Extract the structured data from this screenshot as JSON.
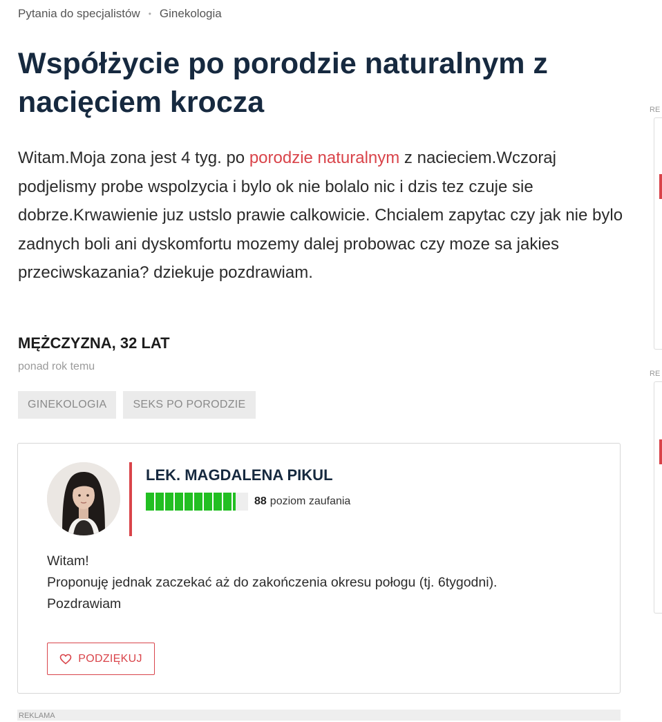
{
  "breadcrumb": {
    "items": [
      "Pytania do specjalistów",
      "Ginekologia"
    ],
    "separator": "•"
  },
  "question": {
    "title": "Współżycie po porodzie naturalnym z nacięciem krocza",
    "body_before_link": "Witam.Moja zona jest 4 tyg. po ",
    "body_link": "porodzie naturalnym",
    "body_after_link": " z nacieciem.Wczoraj podjelismy probe wspolzycia i bylo ok nie bolalo nic i dzis tez czuje sie dobrze.Krwawienie juz ustslo prawie calkowicie. Chcialem zapytac czy jak nie bylo zadnych boli ani dyskomfortu mozemy dalej probowac czy moze sa jakies przeciwskazania? dziekuje pozdrawiam.",
    "author": "MĘŻCZYZNA, 32 LAT",
    "time_ago": "ponad rok temu",
    "tags": [
      "GINEKOLOGIA",
      "SEKS PO PORODZIE"
    ]
  },
  "answer": {
    "doctor_name": "LEK. MAGDALENA PIKUL",
    "trust_score": "88",
    "trust_label": "poziom zaufania",
    "trust_fraction": 0.88,
    "text_lines": [
      "Witam!",
      "Proponuję jednak zaczekać aż do zakończenia okresu połogu (tj. 6tygodni).",
      "Pozdrawiam"
    ],
    "thanks_label": "PODZIĘKUJ",
    "thanks_icon": "heart-outline-icon"
  },
  "ads": {
    "bottom_label": "REKLAMA",
    "side_label_1": "RE",
    "side_label_2": "RE"
  },
  "colors": {
    "accent": "#d9444a",
    "title": "#16293f",
    "trust_green": "#22bf22",
    "tag_bg": "#ebebeb"
  }
}
